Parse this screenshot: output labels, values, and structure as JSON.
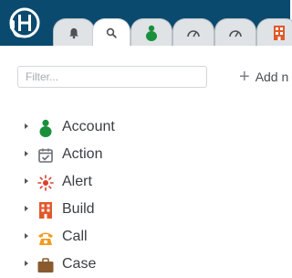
{
  "colors": {
    "topbar": "#0a4a6e",
    "tab_bg": "#dfe3e6",
    "icon_gray": "#4d5257",
    "account_green": "#1a8f3c",
    "alert_red": "#d9402b",
    "build_red": "#e05a2b",
    "call_orange": "#f29a1f",
    "case_brown": "#8a5a2e"
  },
  "tabs": [
    {
      "icon": "bell-icon"
    },
    {
      "icon": "search-icon",
      "active": true
    },
    {
      "icon": "account-icon"
    },
    {
      "icon": "gauge-icon"
    },
    {
      "icon": "gauge-icon"
    },
    {
      "icon": "building-icon"
    }
  ],
  "toolbar": {
    "filter_placeholder": "Filter...",
    "add_label": "Add n"
  },
  "tree": {
    "items": [
      {
        "label": "Account",
        "icon": "account-icon"
      },
      {
        "label": "Action",
        "icon": "calendar-check-icon"
      },
      {
        "label": "Alert",
        "icon": "alert-icon"
      },
      {
        "label": "Build",
        "icon": "building-icon"
      },
      {
        "label": "Call",
        "icon": "phone-icon"
      },
      {
        "label": "Case",
        "icon": "briefcase-icon"
      }
    ]
  }
}
